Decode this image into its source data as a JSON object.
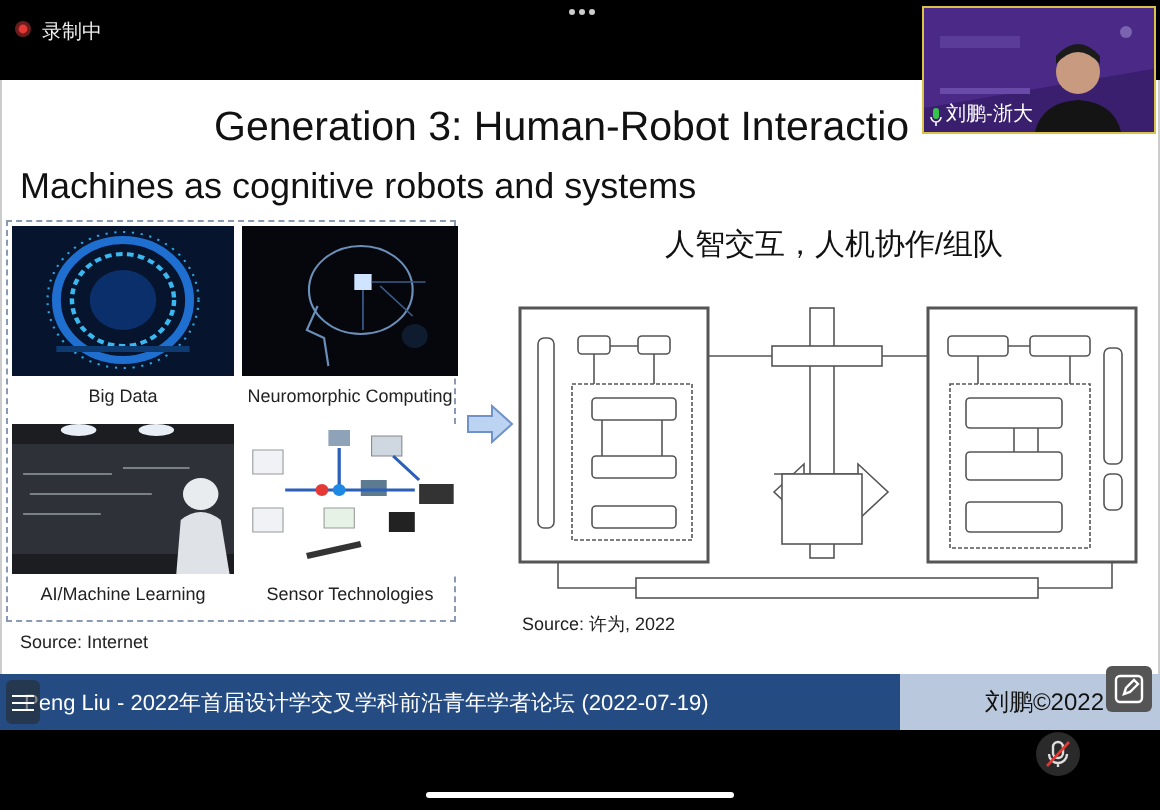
{
  "top_bar": {
    "recording": true,
    "recording_label": "录制中"
  },
  "video_tile": {
    "name": "刘鹏-浙大",
    "mic_on": true
  },
  "slide": {
    "title": "Generation 3: Human-Robot Interactio",
    "subtitle": "Machines as cognitive robots and systems",
    "gallery": [
      {
        "caption": "Big Data",
        "kind": "picture"
      },
      {
        "caption": "Neuromorphic Computing",
        "kind": "picture"
      },
      {
        "caption": "AI/Machine Learning",
        "kind": "picture"
      },
      {
        "caption": "Sensor Technologies",
        "kind": "picture"
      }
    ],
    "gallery_source": "Source: Internet",
    "figure_title": "人智交互，人机协作/组队",
    "figure_source": "Source: 许为, 2022"
  },
  "footer": {
    "left": "Peng Liu - 2022年首届设计学交叉学科前沿青年学者论坛 (2022-07-19)",
    "right": "刘鹏©2022"
  },
  "controls": {
    "mic_muted": true
  }
}
